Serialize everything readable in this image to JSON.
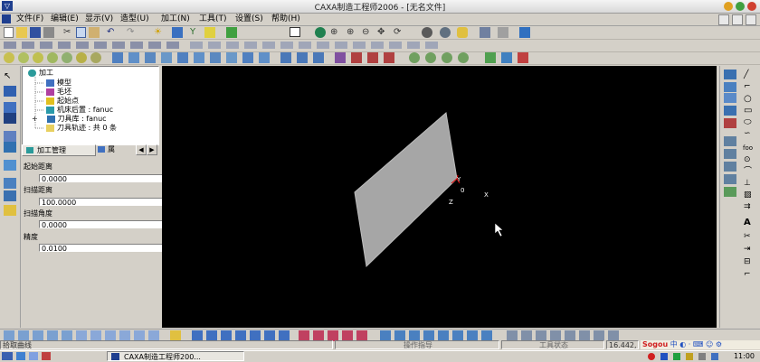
{
  "window": {
    "title": "CAXA制造工程师2006 - [无名文件]"
  },
  "menu": [
    "文件(F)",
    "编辑(E)",
    "显示(V)",
    "造型(U)",
    "加工(N)",
    "工具(T)",
    "设置(S)",
    "帮助(H)"
  ],
  "tree": {
    "root": "加工",
    "items": [
      "模型",
      "毛坯",
      "起始点",
      "机床后置 : fanuc",
      "刀具库 : fanuc",
      "刀具轨迹 : 共 0 条"
    ]
  },
  "tabs": {
    "active": "加工管理",
    "other": "属"
  },
  "properties": [
    {
      "label": "起始距离",
      "value": "0.0000"
    },
    {
      "label": "扫描距离",
      "value": "100.0000"
    },
    {
      "label": "扫描角度",
      "value": "0.0000"
    },
    {
      "label": "精度",
      "value": "0.0100"
    }
  ],
  "viewport": {
    "axes": {
      "y": "Y",
      "x": "X",
      "z": "Z",
      "origin": "0"
    }
  },
  "status": {
    "prompt": "拾取曲线",
    "op_hint": "操作指导",
    "tool_state": "工具状态",
    "coords": "16.442,"
  },
  "taskbar": {
    "app": "CAXA制造工程师200...",
    "clock": "11:00",
    "ime": "Sogou"
  },
  "colors": {
    "viewport_bg": "#000000",
    "surface": "#a6a6a6",
    "axis_red": "#e00000",
    "title_gradient": "#dcdcdc"
  },
  "icons": {
    "top_toolbar": [
      "new-file-icon",
      "open-icon",
      "save-icon",
      "print-icon",
      "cut-icon",
      "copy-icon",
      "paste-icon",
      "undo-icon",
      "redo-icon",
      "light-icon",
      "rotate-icon",
      "zoom-icon",
      "pan-icon"
    ],
    "left_strip": [
      "pointer-icon",
      "edit-icon",
      "layer-icon",
      "view-icon",
      "transform-icon"
    ],
    "right_strip": [
      "line-icon",
      "arc-icon",
      "circle-icon",
      "rect-icon",
      "ellipse-icon",
      "spline-icon",
      "text-icon",
      "dimension-icon"
    ]
  }
}
